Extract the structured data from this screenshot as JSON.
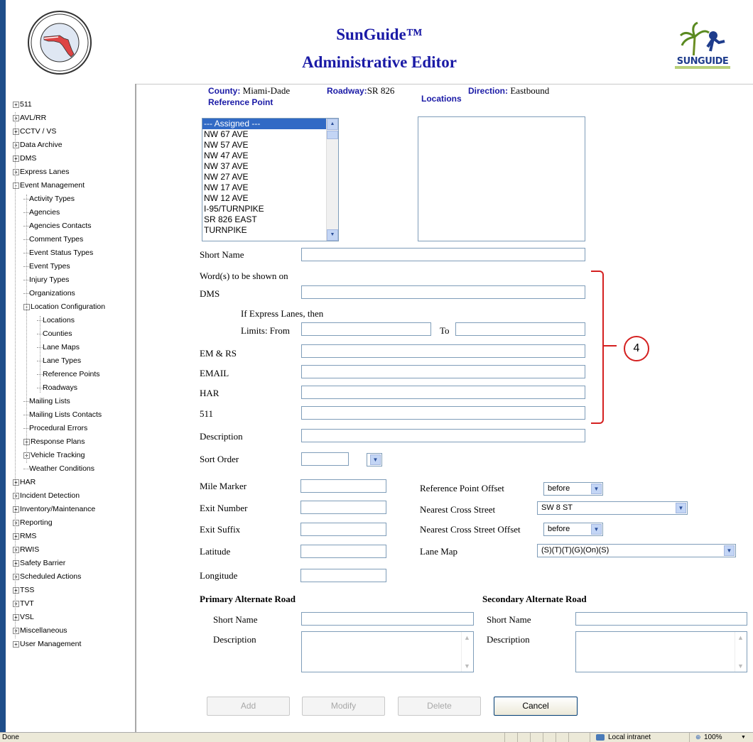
{
  "header": {
    "title_line1": "SunGuide™",
    "title_line2": "Administrative Editor",
    "seal_text": "STATE OF FLORIDA DEPARTMENT OF TRANSPORTATION",
    "logo_text": "SUNGUIDE"
  },
  "tree": {
    "items": [
      {
        "label": "511",
        "expander": "+"
      },
      {
        "label": "AVL/RR",
        "expander": "+"
      },
      {
        "label": "CCTV / VS",
        "expander": "+"
      },
      {
        "label": "Data Archive",
        "expander": "+"
      },
      {
        "label": "DMS",
        "expander": "+"
      },
      {
        "label": "Express Lanes",
        "expander": "+"
      },
      {
        "label": "Event Management",
        "expander": "-"
      },
      {
        "label": "Activity Types"
      },
      {
        "label": "Agencies"
      },
      {
        "label": "Agencies Contacts"
      },
      {
        "label": "Comment Types"
      },
      {
        "label": "Event Status Types"
      },
      {
        "label": "Event Types"
      },
      {
        "label": "Injury Types"
      },
      {
        "label": "Organizations"
      },
      {
        "label": "Location Configuration",
        "expander": "-"
      },
      {
        "label": "Locations"
      },
      {
        "label": "Counties"
      },
      {
        "label": "Lane Maps"
      },
      {
        "label": "Lane Types"
      },
      {
        "label": "Reference Points"
      },
      {
        "label": "Roadways"
      },
      {
        "label": "Mailing Lists"
      },
      {
        "label": "Mailing Lists Contacts"
      },
      {
        "label": "Procedural Errors"
      },
      {
        "label": "Response Plans",
        "expander": "+"
      },
      {
        "label": "Vehicle Tracking",
        "expander": "+"
      },
      {
        "label": "Weather Conditions"
      },
      {
        "label": "HAR",
        "expander": "+"
      },
      {
        "label": "Incident Detection",
        "expander": "+"
      },
      {
        "label": "Inventory/Maintenance",
        "expander": "+"
      },
      {
        "label": "Reporting",
        "expander": "+"
      },
      {
        "label": "RMS",
        "expander": "+"
      },
      {
        "label": "RWIS",
        "expander": "+"
      },
      {
        "label": "Safety Barrier",
        "expander": "+"
      },
      {
        "label": "Scheduled Actions",
        "expander": "+"
      },
      {
        "label": "TSS",
        "expander": "+"
      },
      {
        "label": "TVT",
        "expander": "+"
      },
      {
        "label": "VSL",
        "expander": "+"
      },
      {
        "label": "Miscellaneous",
        "expander": "+"
      },
      {
        "label": "User Management",
        "expander": "+"
      }
    ]
  },
  "form": {
    "county_label": "County:",
    "county_value": "Miami-Dade",
    "roadway_label": "Roadway:",
    "roadway_value": "SR 826",
    "direction_label": "Direction:",
    "direction_value": "Eastbound",
    "reference_point_label": "Reference Point",
    "locations_label": "Locations",
    "reference_points": [
      "--- Assigned ---",
      "NW 67 AVE",
      "NW 57 AVE",
      "NW 47 AVE",
      "NW 37 AVE",
      "NW 27 AVE",
      "NW 17 AVE",
      "NW 12 AVE",
      "I-95/TURNPIKE",
      "SR 826 EAST",
      "TURNPIKE"
    ],
    "short_name_label": "Short Name",
    "words_label": "Word(s) to be shown on",
    "dms_label": "DMS",
    "express_label": "If Express Lanes, then",
    "limits_from_label": "Limits: From",
    "to_label": "To",
    "emrs_label": "EM & RS",
    "email_label": "EMAIL",
    "har_label": "HAR",
    "n511_label": "511",
    "description_label": "Description",
    "sort_order_label": "Sort Order",
    "mile_marker_label": "Mile Marker",
    "exit_number_label": "Exit Number",
    "exit_suffix_label": "Exit Suffix",
    "latitude_label": "Latitude",
    "longitude_label": "Longitude",
    "ref_offset_label": "Reference Point Offset",
    "ref_offset_value": "before",
    "cross_street_label": "Nearest Cross Street",
    "cross_street_value": "SW 8 ST",
    "cross_offset_label": "Nearest Cross Street Offset",
    "cross_offset_value": "before",
    "lane_map_label": "Lane Map",
    "lane_map_value": "(S)(T)(T)(G)(On)(S)",
    "primary_alt_label": "Primary Alternate Road",
    "secondary_alt_label": "Secondary Alternate Road",
    "alt_short_name_label": "Short Name",
    "alt_description_label": "Description"
  },
  "buttons": {
    "add": "Add",
    "modify": "Modify",
    "delete": "Delete",
    "cancel": "Cancel"
  },
  "annotation": {
    "callout_number": "4",
    "color": "#d42020"
  },
  "statusbar": {
    "status": "Done",
    "zone": "Local intranet",
    "zoom": "100%"
  },
  "colors": {
    "accent_blue": "#1a1aa6",
    "selection": "#316ac5",
    "desktop": "#1f4e8a"
  }
}
